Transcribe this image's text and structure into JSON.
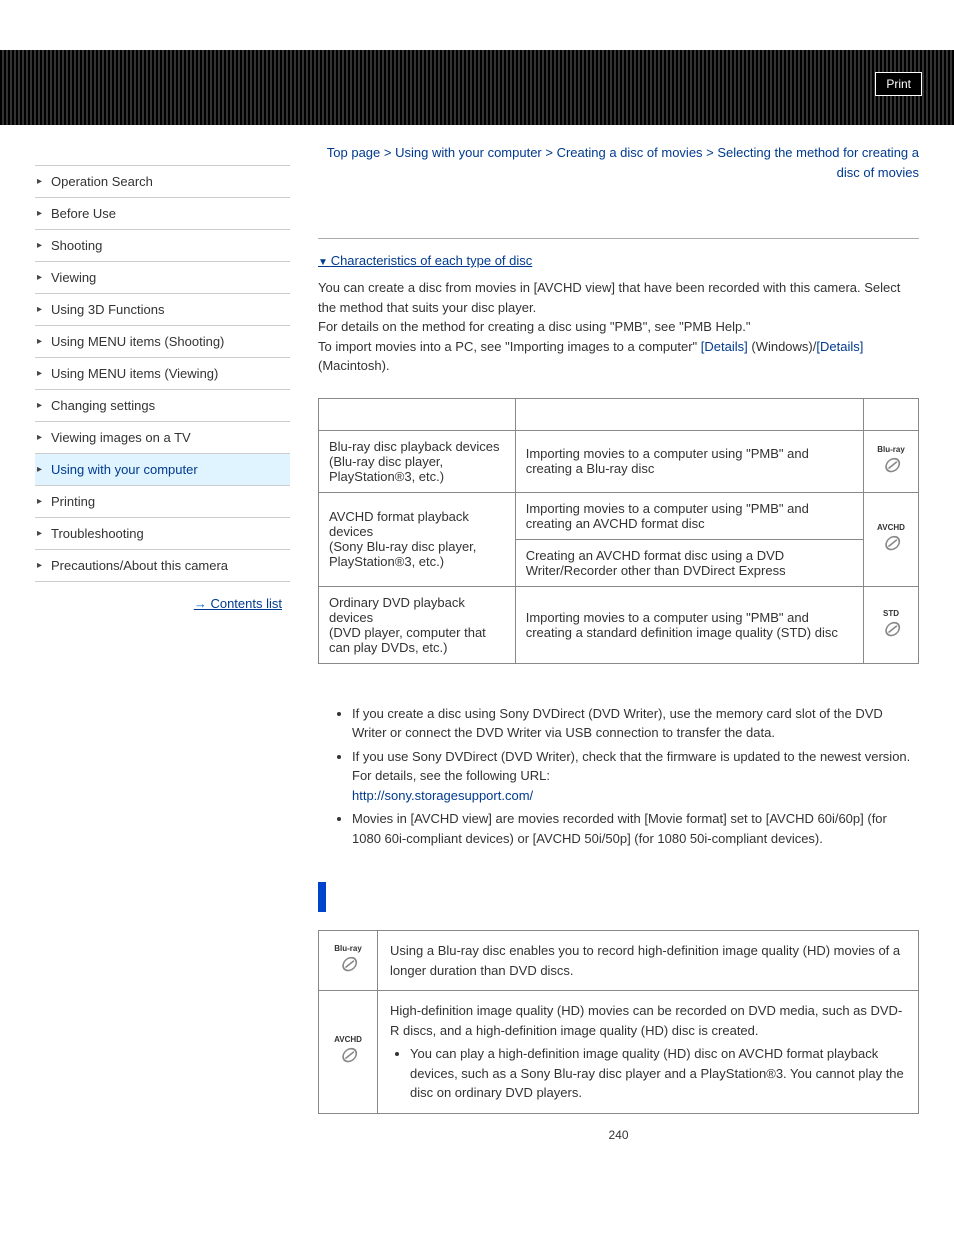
{
  "print_label": "Print",
  "breadcrumb": {
    "top": "Top page",
    "sep": " > ",
    "l1": "Using with your computer",
    "l2": "Creating a disc of movies",
    "l3": "Selecting the method for creating a disc of movies"
  },
  "sidebar": {
    "items": [
      "Operation Search",
      "Before Use",
      "Shooting",
      "Viewing",
      "Using 3D Functions",
      "Using MENU items (Shooting)",
      "Using MENU items (Viewing)",
      "Changing settings",
      "Viewing images on a TV",
      "Using with your computer",
      "Printing",
      "Troubleshooting",
      "Precautions/About this camera"
    ],
    "active_index": 9,
    "contents_list": "Contents list"
  },
  "anchor_link": "Characteristics of each type of disc",
  "intro": {
    "p1": "You can create a disc from movies in [AVCHD view] that have been recorded with this camera. Select the method that suits your disc player.",
    "p2": "For details on the method for creating a disc using \"PMB\", see \"PMB Help.\"",
    "p3a": "To import movies into a PC, see \"Importing images to a computer\" ",
    "details1": "[Details]",
    "p3b": " (Windows)/",
    "details2": "[Details]",
    "p3c": " (Macintosh)."
  },
  "table1": {
    "rows": [
      {
        "player_a": "Blu-ray disc playback devices",
        "player_b": "(Blu-ray disc player, PlayStation®3, etc.)",
        "methods": [
          "Importing movies to a computer using \"PMB\" and creating a Blu-ray disc"
        ],
        "icon": "Blu-ray"
      },
      {
        "player_a": "AVCHD format playback devices",
        "player_b": "(Sony Blu-ray disc player, PlayStation®3, etc.)",
        "methods": [
          "Importing movies to a computer using \"PMB\" and creating an AVCHD format disc",
          "Creating an AVCHD format disc using a DVD Writer/Recorder other than DVDirect Express"
        ],
        "icon": "AVCHD"
      },
      {
        "player_a": "Ordinary DVD playback devices",
        "player_b": "(DVD player, computer that can play DVDs, etc.)",
        "methods": [
          "Importing movies to a computer using \"PMB\" and creating a standard definition image quality (STD) disc"
        ],
        "icon": "STD"
      }
    ]
  },
  "notes": {
    "n1": "If you create a disc using Sony DVDirect (DVD Writer), use the memory card slot of the DVD Writer or connect the DVD Writer via USB connection to transfer the data.",
    "n2a": "If you use Sony DVDirect (DVD Writer), check that the firmware is updated to the newest version.",
    "n2b": "For details, see the following URL:",
    "n2url": "http://sony.storagesupport.com/",
    "n3": "Movies in [AVCHD view] are movies recorded with [Movie format] set to [AVCHD 60i/60p] (for 1080 60i-compliant devices) or [AVCHD 50i/50p] (for 1080 50i-compliant devices)."
  },
  "char_table": {
    "rows": [
      {
        "icon": "Blu-ray",
        "text": "Using a Blu-ray disc enables you to record high-definition image quality (HD) movies of a longer duration than DVD discs."
      },
      {
        "icon": "AVCHD",
        "text": "High-definition image quality (HD) movies can be recorded on DVD media, such as DVD-R discs, and a high-definition image quality (HD) disc is created.",
        "bullet": "You can play a high-definition image quality (HD) disc on AVCHD format playback devices, such as a Sony Blu-ray disc player and a PlayStation®3. You cannot play the disc on ordinary DVD players."
      }
    ]
  },
  "page_number": "240"
}
